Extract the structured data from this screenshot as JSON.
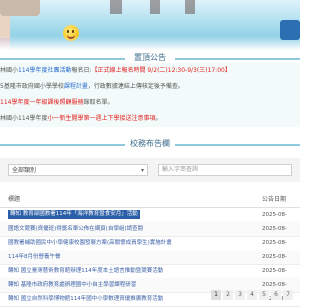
{
  "sections": {
    "announcements_title": "置頂公告",
    "school_news_title": "校務布告欄"
  },
  "announcements": [
    [
      {
        "text": "林國小",
        "c": "grey"
      },
      {
        "text": "114學年度社團活動",
        "c": "blue"
      },
      {
        "text": "報名日:",
        "c": "grey"
      },
      {
        "text": "【正式線上報名時間 9/2(二)12:30-9/3(三)17:00】",
        "c": "red"
      }
    ],
    [
      {
        "text": "5基隆市政府國小學學校",
        "c": "grey"
      },
      {
        "text": "課程計畫",
        "c": "blue"
      },
      {
        "text": "，行政數據連結上傳核定後予備查。",
        "c": "grey"
      }
    ],
    [
      {
        "text": "114學年度一年級課後照顧服務",
        "c": "red"
      },
      {
        "text": "錄取名單。",
        "c": "grey"
      }
    ],
    [
      {
        "text": "林國小114學年度",
        "c": "grey"
      },
      {
        "text": "小一新生開學第一週上下學接送注意事項",
        "c": "red"
      },
      {
        "text": "。",
        "c": "grey"
      }
    ]
  ],
  "search": {
    "select_value": "全部類別",
    "keyword_placeholder": "輸入字串查詢"
  },
  "table": {
    "col_title": "標題",
    "col_date": "公告日期",
    "rows": [
      {
        "title": "轉知 教育部國教署114年「海洋教育暨食安月」活動",
        "date": "2025-08-",
        "selected": true
      },
      {
        "title": "國語文競賽(資優班)得獎名單公佈在網頁(自學組)請查閱",
        "date": "2025-08-"
      },
      {
        "title": "國教署補助國民中小學健康校園發展方案(高關懷成員學生)實施計畫",
        "date": "2025-08-"
      },
      {
        "title": "114年8月份營養午餐",
        "date": "2025-08-"
      },
      {
        "title": "轉知 國立臺灣藝術教育館辦理114年度本土語言推動暨競賽活動",
        "date": "2025-08-"
      },
      {
        "title": "轉知 基隆市政府教育處辦理國中小自主學習課程研習",
        "date": "2025-08-"
      },
      {
        "title": "轉知 國立自然科學博物館114年國中小學數理資優推廣教育活動",
        "date": "2025-08-"
      }
    ]
  },
  "pager": {
    "pages": [
      "1",
      "2",
      "3",
      "4",
      "5",
      "6",
      "7"
    ],
    "active": "1"
  }
}
